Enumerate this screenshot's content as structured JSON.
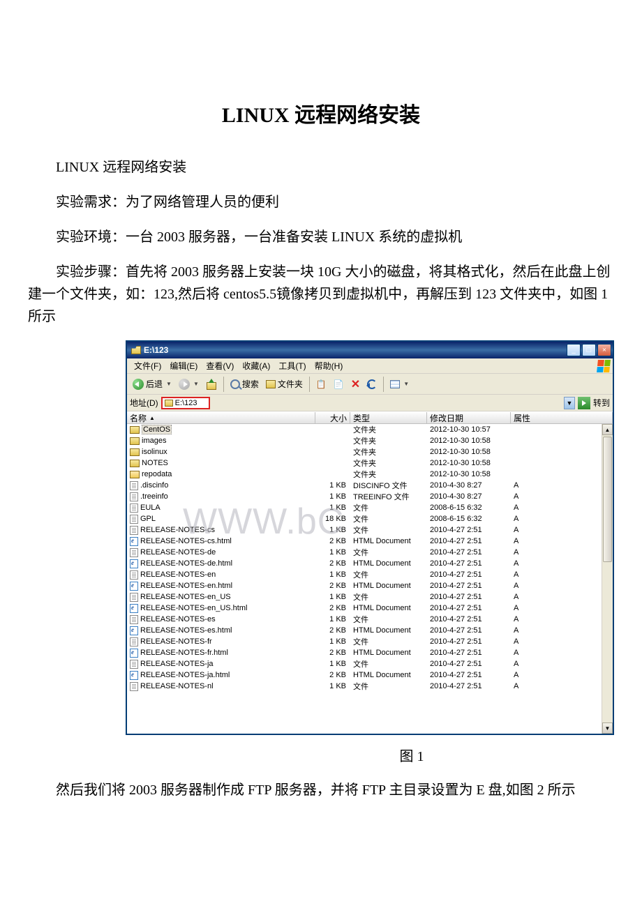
{
  "doc": {
    "title": "LINUX 远程网络安装",
    "p1": "LINUX 远程网络安装",
    "p2": "实验需求：为了网络管理人员的便利",
    "p3": "实验环境：一台 2003 服务器，一台准备安装 LINUX 系统的虚拟机",
    "p4": "实验步骤：首先将 2003 服务器上安装一块 10G 大小的磁盘，将其格式化，然后在此盘上创建一个文件夹，如：123,然后将 centos5.5镜像拷贝到虚拟机中，再解压到 123 文件夹中，如图 1 所示",
    "fig1": "图 1",
    "p5": "然后我们将 2003 服务器制作成 FTP 服务器，并将 FTP 主目录设置为 E 盘,如图 2 所示"
  },
  "explorer": {
    "title": "E:\\123",
    "menus": {
      "file": "文件(F)",
      "edit": "编辑(E)",
      "view": "查看(V)",
      "fav": "收藏(A)",
      "tools": "工具(T)",
      "help": "帮助(H)"
    },
    "toolbar": {
      "back": "后退",
      "search": "搜索",
      "folders": "文件夹"
    },
    "address": {
      "label": "地址(D)",
      "value": "E:\\123",
      "go": "转到"
    },
    "columns": {
      "name": "名称",
      "size": "大小",
      "type": "类型",
      "date": "修改日期",
      "attr": "属性"
    },
    "watermark": "WWW.bC",
    "rows": [
      {
        "icon": "folder",
        "selected": true,
        "name": "CentOS",
        "size": "",
        "type": "文件夹",
        "date": "2012-10-30 10:57",
        "attr": ""
      },
      {
        "icon": "folder",
        "name": "images",
        "size": "",
        "type": "文件夹",
        "date": "2012-10-30 10:58",
        "attr": ""
      },
      {
        "icon": "folder",
        "name": "isolinux",
        "size": "",
        "type": "文件夹",
        "date": "2012-10-30 10:58",
        "attr": ""
      },
      {
        "icon": "folder",
        "name": "NOTES",
        "size": "",
        "type": "文件夹",
        "date": "2012-10-30 10:58",
        "attr": ""
      },
      {
        "icon": "folder-open",
        "name": "repodata",
        "size": "",
        "type": "文件夹",
        "date": "2012-10-30 10:58",
        "attr": ""
      },
      {
        "icon": "file",
        "name": ".discinfo",
        "size": "1 KB",
        "type": "DISCINFO 文件",
        "date": "2010-4-30 8:27",
        "attr": "A"
      },
      {
        "icon": "file",
        "name": ".treeinfo",
        "size": "1 KB",
        "type": "TREEINFO 文件",
        "date": "2010-4-30 8:27",
        "attr": "A"
      },
      {
        "icon": "file",
        "name": "EULA",
        "size": "1 KB",
        "type": "文件",
        "date": "2008-6-15 6:32",
        "attr": "A"
      },
      {
        "icon": "file",
        "name": "GPL",
        "size": "18 KB",
        "type": "文件",
        "date": "2008-6-15 6:32",
        "attr": "A"
      },
      {
        "icon": "file",
        "name": "RELEASE-NOTES-cs",
        "size": "1 KB",
        "type": "文件",
        "date": "2010-4-27 2:51",
        "attr": "A"
      },
      {
        "icon": "html",
        "name": "RELEASE-NOTES-cs.html",
        "size": "2 KB",
        "type": "HTML Document",
        "date": "2010-4-27 2:51",
        "attr": "A"
      },
      {
        "icon": "file",
        "name": "RELEASE-NOTES-de",
        "size": "1 KB",
        "type": "文件",
        "date": "2010-4-27 2:51",
        "attr": "A"
      },
      {
        "icon": "html",
        "name": "RELEASE-NOTES-de.html",
        "size": "2 KB",
        "type": "HTML Document",
        "date": "2010-4-27 2:51",
        "attr": "A"
      },
      {
        "icon": "file",
        "name": "RELEASE-NOTES-en",
        "size": "1 KB",
        "type": "文件",
        "date": "2010-4-27 2:51",
        "attr": "A"
      },
      {
        "icon": "html",
        "name": "RELEASE-NOTES-en.html",
        "size": "2 KB",
        "type": "HTML Document",
        "date": "2010-4-27 2:51",
        "attr": "A"
      },
      {
        "icon": "file",
        "name": "RELEASE-NOTES-en_US",
        "size": "1 KB",
        "type": "文件",
        "date": "2010-4-27 2:51",
        "attr": "A"
      },
      {
        "icon": "html",
        "name": "RELEASE-NOTES-en_US.html",
        "size": "2 KB",
        "type": "HTML Document",
        "date": "2010-4-27 2:51",
        "attr": "A"
      },
      {
        "icon": "file",
        "name": "RELEASE-NOTES-es",
        "size": "1 KB",
        "type": "文件",
        "date": "2010-4-27 2:51",
        "attr": "A"
      },
      {
        "icon": "html",
        "name": "RELEASE-NOTES-es.html",
        "size": "2 KB",
        "type": "HTML Document",
        "date": "2010-4-27 2:51",
        "attr": "A"
      },
      {
        "icon": "file",
        "name": "RELEASE-NOTES-fr",
        "size": "1 KB",
        "type": "文件",
        "date": "2010-4-27 2:51",
        "attr": "A"
      },
      {
        "icon": "html",
        "name": "RELEASE-NOTES-fr.html",
        "size": "2 KB",
        "type": "HTML Document",
        "date": "2010-4-27 2:51",
        "attr": "A"
      },
      {
        "icon": "file",
        "name": "RELEASE-NOTES-ja",
        "size": "1 KB",
        "type": "文件",
        "date": "2010-4-27 2:51",
        "attr": "A"
      },
      {
        "icon": "html",
        "name": "RELEASE-NOTES-ja.html",
        "size": "2 KB",
        "type": "HTML Document",
        "date": "2010-4-27 2:51",
        "attr": "A"
      },
      {
        "icon": "file",
        "name": "RELEASE-NOTES-nl",
        "size": "1 KB",
        "type": "文件",
        "date": "2010-4-27 2:51",
        "attr": "A"
      }
    ]
  }
}
